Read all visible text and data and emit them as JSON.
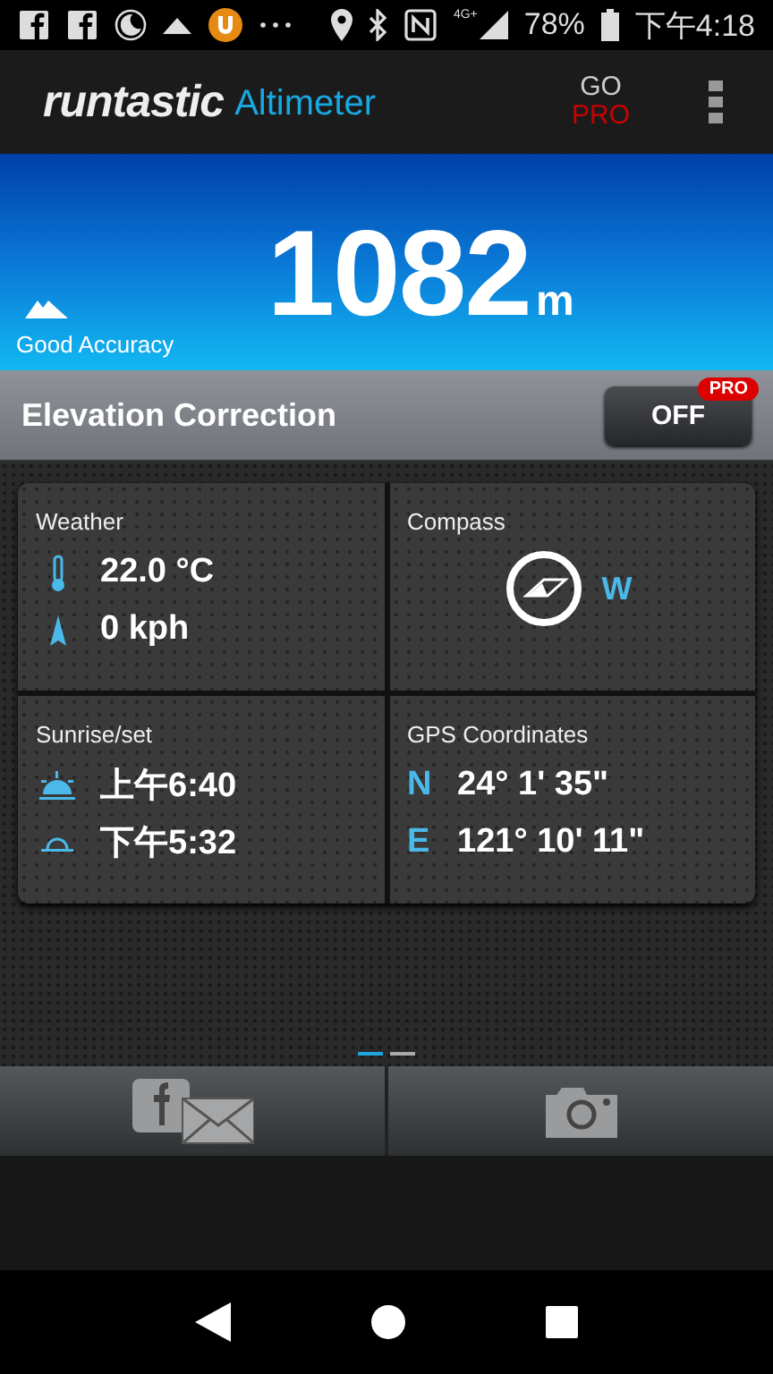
{
  "status_bar": {
    "network": "4G+",
    "battery": "78%",
    "time": "下午4:18"
  },
  "app_bar": {
    "logo": "runtastic",
    "title": "Altimeter",
    "go": "GO",
    "pro": "PRO"
  },
  "altitude": {
    "value": "1082",
    "unit": "m",
    "accuracy": "Good Accuracy"
  },
  "elevation_correction": {
    "label": "Elevation Correction",
    "toggle": "OFF",
    "on": false,
    "badge": "PRO"
  },
  "tiles": [
    {
      "kind": "weather",
      "title": "Weather",
      "rows": [
        {
          "kind": "temperature",
          "value": "22.0 °C"
        },
        {
          "kind": "wind",
          "value": "0 kph"
        }
      ]
    },
    {
      "kind": "compass",
      "title": "Compass",
      "direction": "W"
    },
    {
      "kind": "sun",
      "title": "Sunrise/set",
      "rows": [
        {
          "kind": "sunrise",
          "value": "上午6:40"
        },
        {
          "kind": "sunset",
          "value": "下午5:32"
        }
      ]
    },
    {
      "kind": "gps",
      "title": "GPS Coordinates",
      "rows": [
        {
          "label": "N",
          "value": "24° 1' 35\""
        },
        {
          "label": "E",
          "value": "121° 10' 11\""
        }
      ]
    }
  ],
  "pages": [
    {
      "selected": true
    },
    {
      "selected": false
    }
  ]
}
